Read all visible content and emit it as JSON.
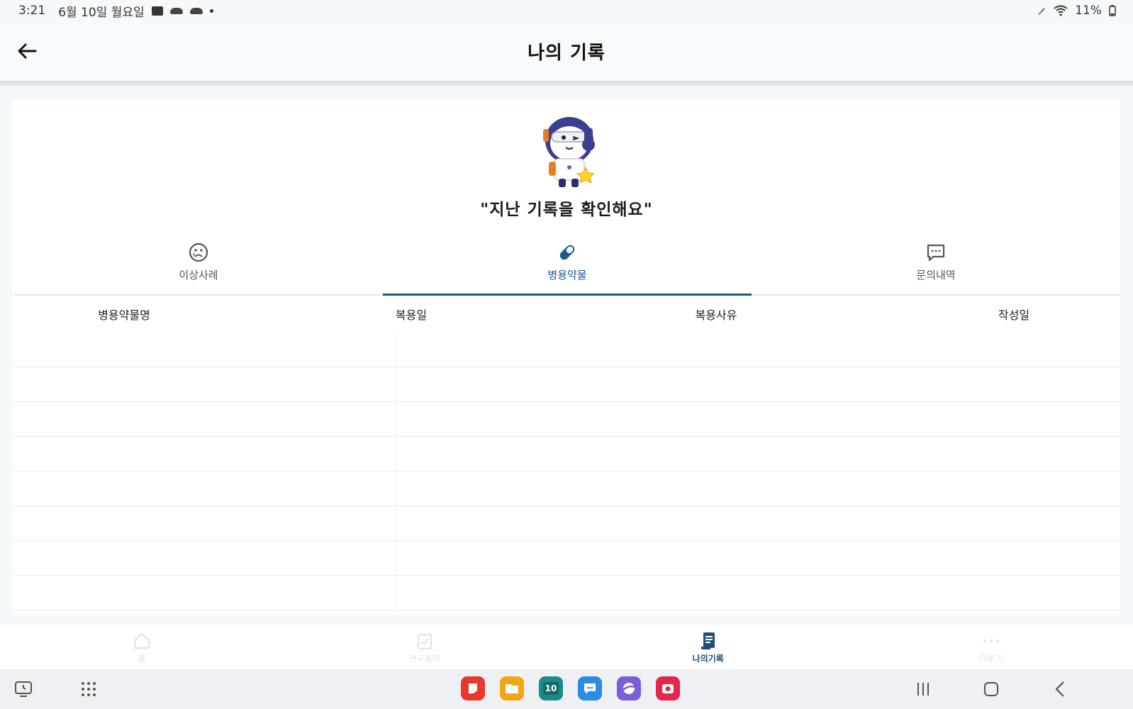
{
  "status_bar": {
    "time": "3:21",
    "date": "6월 10일 월요일",
    "battery": "11%"
  },
  "header": {
    "title": "나의 기록"
  },
  "hero": {
    "subtitle": "\"지난 기록을 확인해요\""
  },
  "tabs": [
    {
      "label": "이상사례",
      "icon": "sad-face-icon",
      "active": false
    },
    {
      "label": "병용약물",
      "icon": "pill-icon",
      "active": true
    },
    {
      "label": "문의내역",
      "icon": "chat-bubble-icon",
      "active": false
    }
  ],
  "table": {
    "headers": [
      "병용약물명",
      "복용일",
      "복용사유",
      "작성일"
    ],
    "rows": []
  },
  "bottom_nav": [
    {
      "label": "홈",
      "icon": "home-icon",
      "active": false
    },
    {
      "label": "연구동의",
      "icon": "clipboard-check-icon",
      "active": false
    },
    {
      "label": "나의기록",
      "icon": "document-list-icon",
      "active": true
    },
    {
      "label": "더보기",
      "icon": "more-dots-icon",
      "active": false
    }
  ],
  "dock_apps": [
    {
      "name": "red-notes-app-icon",
      "color": "#e8372d"
    },
    {
      "name": "folder-app-icon",
      "color": "#f2a516"
    },
    {
      "name": "calendar-app-icon",
      "color": "#1b8a8a",
      "text": "10"
    },
    {
      "name": "messages-app-icon",
      "color": "#2a8ce6"
    },
    {
      "name": "internet-app-icon",
      "color": "#7a5fd6"
    },
    {
      "name": "camera-app-icon",
      "color": "#e3264a"
    }
  ],
  "colors": {
    "accent": "#1f5a8c",
    "background": "#f6f9fb"
  }
}
